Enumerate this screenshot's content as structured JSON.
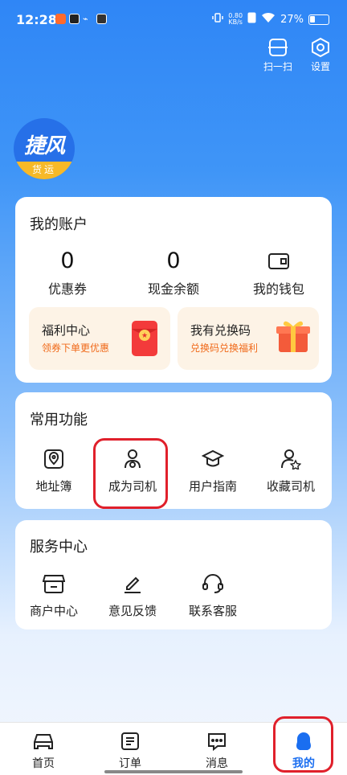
{
  "status_bar": {
    "time": "12:28",
    "net_speed": "0.80\nKB/s",
    "battery": "27%"
  },
  "header": {
    "scan_label": "扫一扫",
    "settings_label": "设置"
  },
  "logo": {
    "main_text": "捷风",
    "sub_text": "货运"
  },
  "account": {
    "title": "我的账户",
    "coupons_value": "0",
    "coupons_label": "优惠券",
    "cash_value": "0",
    "cash_label": "现金余额",
    "wallet_label": "我的钱包",
    "welfare_title": "福利中心",
    "welfare_sub": "领券下单更优惠",
    "code_title": "我有兑换码",
    "code_sub": "兑换码兑换福利"
  },
  "functions": {
    "title": "常用功能",
    "items": [
      {
        "label": "地址簿",
        "icon": "map-pin-icon"
      },
      {
        "label": "成为司机",
        "icon": "driver-icon"
      },
      {
        "label": "用户指南",
        "icon": "graduation-cap-icon"
      },
      {
        "label": "收藏司机",
        "icon": "favorite-driver-icon"
      }
    ]
  },
  "service": {
    "title": "服务中心",
    "items": [
      {
        "label": "商户中心",
        "icon": "store-icon"
      },
      {
        "label": "意见反馈",
        "icon": "edit-icon"
      },
      {
        "label": "联系客服",
        "icon": "headset-icon"
      }
    ]
  },
  "bottom_nav": {
    "items": [
      {
        "label": "首页",
        "icon": "car-icon"
      },
      {
        "label": "订单",
        "icon": "order-list-icon"
      },
      {
        "label": "消息",
        "icon": "message-icon"
      },
      {
        "label": "我的",
        "icon": "profile-icon",
        "active": true
      }
    ]
  },
  "colors": {
    "accent": "#1a6ef0",
    "highlight": "#e0202b",
    "promo_text": "#f06a1a"
  }
}
